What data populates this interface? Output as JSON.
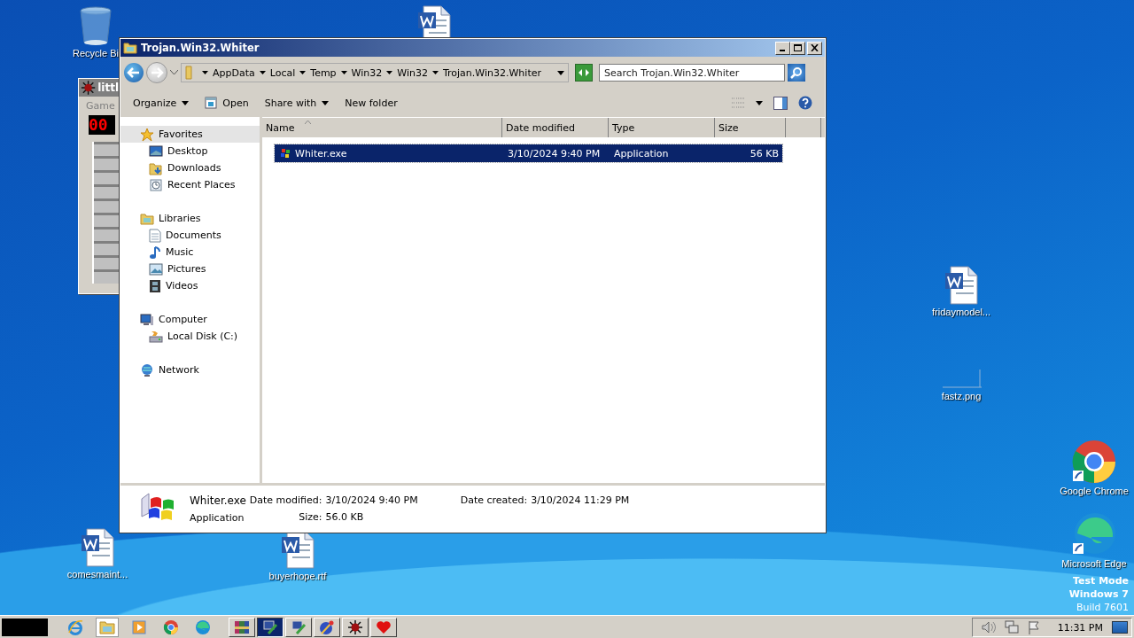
{
  "desktop_icons": [
    {
      "label": "Recycle Bi",
      "kind": "recycle"
    },
    {
      "kind": "word"
    },
    {
      "label": "fridaymodel...",
      "kind": "word"
    },
    {
      "label": "fastz.png",
      "kind": "image"
    },
    {
      "label": "Google Chrome",
      "kind": "chrome"
    },
    {
      "label": "Microsoft Edge",
      "kind": "edge"
    },
    {
      "label": "comesmaint...",
      "kind": "word"
    },
    {
      "label": "buyerhope.rtf",
      "kind": "word"
    }
  ],
  "game_window": {
    "title": "littl",
    "menu": "Game",
    "counter": "00"
  },
  "window": {
    "title": "Trojan.Win32.Whiter",
    "breadcrumbs": [
      "AppData",
      "Local",
      "Temp",
      "Win32",
      "Win32",
      "Trojan.Win32.Whiter"
    ],
    "search": {
      "placeholder": "Search Trojan.Win32.Whiter"
    },
    "toolbar": [
      {
        "label": "Organize",
        "kind": "menu"
      },
      {
        "label": "Open",
        "kind": "open"
      },
      {
        "label": "Share with",
        "kind": "menu"
      },
      {
        "label": "New folder",
        "kind": "plain"
      }
    ],
    "nav": [
      {
        "label": "Favorites",
        "kind": "star",
        "selected": true,
        "children": [
          {
            "label": "Desktop",
            "kind": "desktop",
            "selected": false
          },
          {
            "label": "Downloads",
            "kind": "downloads",
            "selected": false
          },
          {
            "label": "Recent Places",
            "kind": "recent",
            "selected": false
          }
        ]
      },
      {
        "label": "Libraries",
        "kind": "libraries",
        "selected": false,
        "children": [
          {
            "label": "Documents",
            "kind": "documents",
            "selected": false
          },
          {
            "label": "Music",
            "kind": "music",
            "selected": false
          },
          {
            "label": "Pictures",
            "kind": "pictures",
            "selected": false
          },
          {
            "label": "Videos",
            "kind": "videos",
            "selected": false
          }
        ]
      },
      {
        "label": "Computer",
        "kind": "computer",
        "selected": false,
        "children": [
          {
            "label": "Local Disk (C:)",
            "kind": "disk",
            "selected": false
          }
        ]
      },
      {
        "label": "Network",
        "kind": "network",
        "selected": false
      }
    ],
    "columns": [
      "Name",
      "Date modified",
      "Type",
      "Size"
    ],
    "rows": [
      {
        "cells": [
          "Whiter.exe",
          "3/10/2024 9:40 PM",
          "Application",
          "56 KB"
        ],
        "selected": true
      }
    ],
    "details": {
      "name": "Whiter.exe",
      "type": "Application",
      "fields": [
        {
          "label": "Date modified:",
          "value": "3/10/2024 9:40 PM"
        },
        {
          "label": "Date created:",
          "value": "3/10/2024 11:29 PM"
        },
        {
          "label": "Size:",
          "value": "56.0 KB"
        }
      ]
    }
  },
  "system_text": [
    "Test Mode",
    "Windows 7",
    "Build 7601"
  ],
  "taskbar": {
    "quick_launch": [
      {
        "kind": "ie",
        "selected": false
      },
      {
        "kind": "explorer",
        "selected": true
      },
      {
        "kind": "media",
        "selected": false
      },
      {
        "kind": "chrome",
        "selected": false
      },
      {
        "kind": "edge",
        "selected": false
      }
    ],
    "programs": [
      {
        "kind": "books",
        "selected": false
      },
      {
        "kind": "monitor",
        "selected": true
      },
      {
        "kind": "monitor",
        "selected": false
      },
      {
        "kind": "globe",
        "selected": false
      },
      {
        "kind": "mine",
        "selected": false
      },
      {
        "kind": "heart",
        "selected": false
      }
    ],
    "clock": "11:31 PM"
  }
}
